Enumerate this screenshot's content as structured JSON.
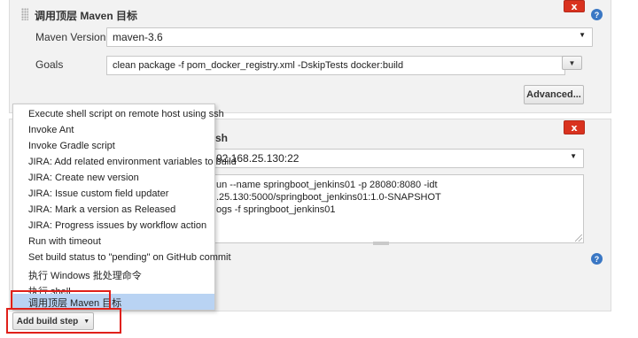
{
  "step_maven": {
    "title": "调用顶层 Maven 目标",
    "delete_label": "x",
    "help_label": "?",
    "maven_version_label": "Maven Version",
    "maven_version_value": "maven-3.6",
    "goals_label": "Goals",
    "goals_value": "clean package -f pom_docker_registry.xml  -DskipTests docker:build",
    "advanced_label": "Advanced..."
  },
  "step_ssh": {
    "title_fragment": "sh",
    "delete_label": "x",
    "help_label": "?",
    "host_value": "92.168.25.130:22",
    "command_lines": [
      "un --name springboot_jenkins01 -p 28080:8080 -idt",
      ".25.130:5000/springboot_jenkins01:1.0-SNAPSHOT",
      "ogs -f springboot_jenkins01"
    ]
  },
  "menu": {
    "items": [
      "Execute shell script on remote host using ssh",
      "Invoke Ant",
      "Invoke Gradle script",
      "JIRA: Add related environment variables to build",
      "JIRA: Create new version",
      "JIRA: Issue custom field updater",
      "JIRA: Mark a version as Released",
      "JIRA: Progress issues by workflow action",
      "Run with timeout",
      "Set build status to \"pending\" on GitHub commit",
      "执行 Windows 批处理命令",
      "执行 shell",
      "调用顶层 Maven 目标"
    ],
    "selected_index": 12
  },
  "add_build_step": {
    "label": "Add build step"
  },
  "colors": {
    "delete": "#d9321f",
    "help": "#3a77c4",
    "selection": "#b9d3f3",
    "highlight": "#e0201a"
  }
}
